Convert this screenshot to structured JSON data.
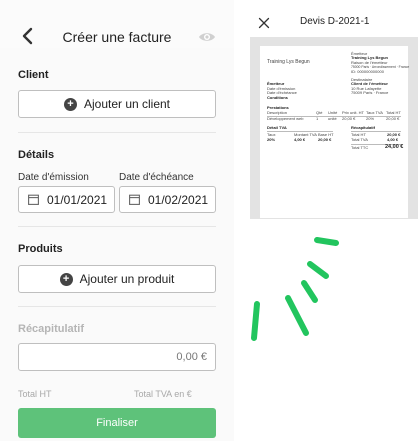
{
  "header": {
    "title": "Créer une facture",
    "back_icon": "chevron-left-icon",
    "preview_icon": "eye-icon"
  },
  "client": {
    "section": "Client",
    "add_button": "Ajouter un client"
  },
  "details": {
    "section": "Détails",
    "issue_label": "Date d'émission",
    "issue_date": "01/01/2021",
    "due_label": "Date d'échéance",
    "due_date": "01/02/2021"
  },
  "products": {
    "section": "Produits",
    "add_button": "Ajouter un produit"
  },
  "summary": {
    "section": "Récapitulatif",
    "amount": "0,00 €",
    "total_ht_label": "Total HT",
    "total_tva_label": "Total TVA en €"
  },
  "finalize_button": "Finaliser",
  "preview": {
    "title": "Devis D-2021-1",
    "company": "Training Lys Begun",
    "emitter_head": "Émetteur",
    "emitter_name": "Training Lys Begun",
    "emitter_l1": "Raison de l'émetteur",
    "emitter_l2": "75000 Paris · Arrondissement · France",
    "emitter_l3": "ID: 000000000000",
    "dest_head": "Destinataire",
    "dest_name": "Client de l'émetteur",
    "dest_l1": "10 Rue Lafayette",
    "dest_l2": "75009 Paris · France",
    "left_h1": "Émetteur",
    "left_l1": "Date d'émission",
    "left_l2": "Date d'échéance",
    "left_l3": "Conditions",
    "products_head": "Prestations",
    "col_desc": "Description",
    "col_qty": "Qté",
    "col_unit": "Unité",
    "col_pu": "Prix unit. HT",
    "col_tva": "Taux TVA",
    "col_total": "Total HT",
    "row_desc": "Développement web",
    "row_qty": "1",
    "row_unit": "unité",
    "row_pu": "20,00 €",
    "row_tva": "20%",
    "row_total": "20,00 €",
    "tva_head": "Détail TVA",
    "recap_head": "Récapitulatif",
    "tva_l1": "Taux",
    "tva_l2": "Montant TVA",
    "tva_l3": "Base HT",
    "tva_v1": "20%",
    "tva_v2": "4,00 €",
    "tva_v3": "20,00 €",
    "recap_l1": "Total HT",
    "recap_l2": "Total TVA",
    "recap_l3": "Total TTC",
    "recap_v1": "20,00 €",
    "recap_v2": "4,00 €",
    "recap_v3": "24,00 €"
  },
  "colors": {
    "accent_green": "#5ec27a",
    "spinner_green": "#22c55e"
  }
}
